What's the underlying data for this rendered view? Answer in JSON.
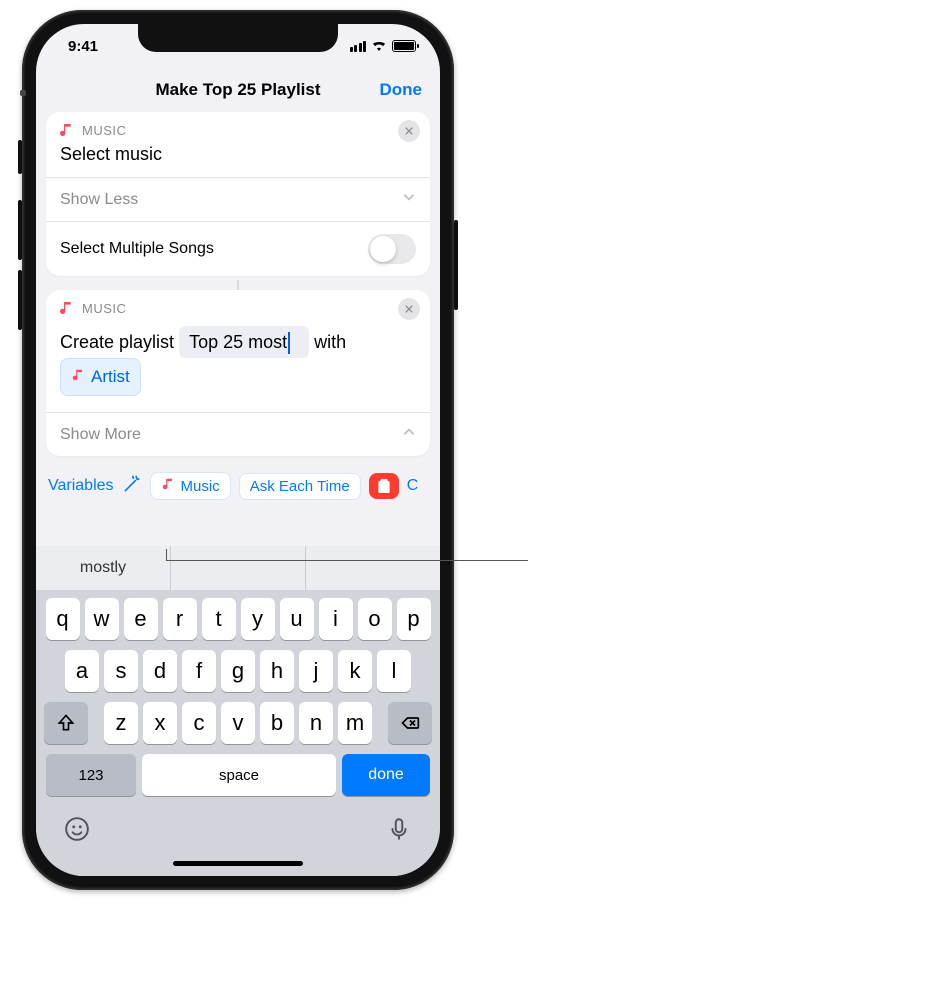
{
  "status": {
    "time": "9:41"
  },
  "nav": {
    "title": "Make Top 25 Playlist",
    "done": "Done"
  },
  "card1": {
    "app": "MUSIC",
    "title": "Select music",
    "show_less": "Show Less",
    "toggle_label": "Select Multiple Songs"
  },
  "card2": {
    "app": "MUSIC",
    "prefix": "Create playlist",
    "field_value": "Top 25 most",
    "mid": "with",
    "token_label": "Artist",
    "show_more": "Show More"
  },
  "varbar": {
    "variables": "Variables",
    "music": "Music",
    "ask": "Ask Each Time",
    "clip_cutoff": "C"
  },
  "kb": {
    "suggest": "mostly",
    "rows": {
      "r1": [
        "q",
        "w",
        "e",
        "r",
        "t",
        "y",
        "u",
        "i",
        "o",
        "p"
      ],
      "r2": [
        "a",
        "s",
        "d",
        "f",
        "g",
        "h",
        "j",
        "k",
        "l"
      ],
      "r3": [
        "z",
        "x",
        "c",
        "v",
        "b",
        "n",
        "m"
      ]
    },
    "num": "123",
    "space": "space",
    "done": "done"
  }
}
